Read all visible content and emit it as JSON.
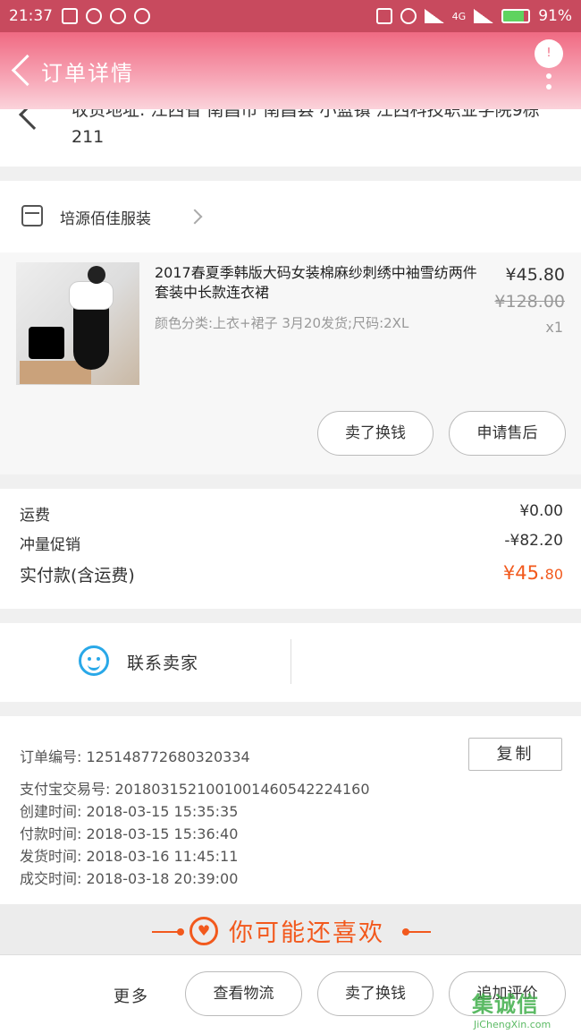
{
  "status_bar": {
    "time": "21:37",
    "network": "4G",
    "battery": "91%"
  },
  "header": {
    "title": "订单详情",
    "badge": "!"
  },
  "address": {
    "text": "收货地址: 江西省 南昌市 南昌县 小蓝镇 江西科技职业学院9栋211"
  },
  "shop": {
    "name": "培源佰佳服装"
  },
  "product": {
    "title": "2017春夏季韩版大码女装棉麻纱刺绣中袖雪纺两件套装中长款连衣裙",
    "sku": "颜色分类:上衣+裙子 3月20发货;尺码:2XL",
    "price": "¥45.80",
    "original_price": "¥128.00",
    "quantity": "x1",
    "btn_sell": "卖了换钱",
    "btn_after_sale": "申请售后"
  },
  "summary": {
    "shipping_label": "运费",
    "shipping_value": "¥0.00",
    "promo_label": "冲量促销",
    "promo_value": "-¥82.20",
    "paid_label": "实付款(含运费)",
    "paid_value_main": "¥45.",
    "paid_value_cents": "80"
  },
  "contact": {
    "label": "联系卖家"
  },
  "order_info": {
    "order_no": "订单编号:  125148772680320334",
    "alipay_no": "支付宝交易号:  2018031521001001460542224160",
    "created": "创建时间:  2018-03-15 15:35:35",
    "paid": "付款时间:  2018-03-15 15:36:40",
    "shipped": "发货时间:  2018-03-16 11:45:11",
    "completed": "成交时间:  2018-03-18 20:39:00",
    "copy_label": "复制"
  },
  "recommend": {
    "title": "你可能还喜欢"
  },
  "bottom_bar": {
    "more": "更多",
    "btn_logistics": "查看物流",
    "btn_sell": "卖了换钱",
    "btn_review": "追加评价"
  },
  "watermark": {
    "logo": "集诚信",
    "site": "JiChengXin.com"
  },
  "colors": {
    "accent": "#f2591d",
    "header": "#f06a82",
    "contact_icon": "#29a8e8"
  }
}
